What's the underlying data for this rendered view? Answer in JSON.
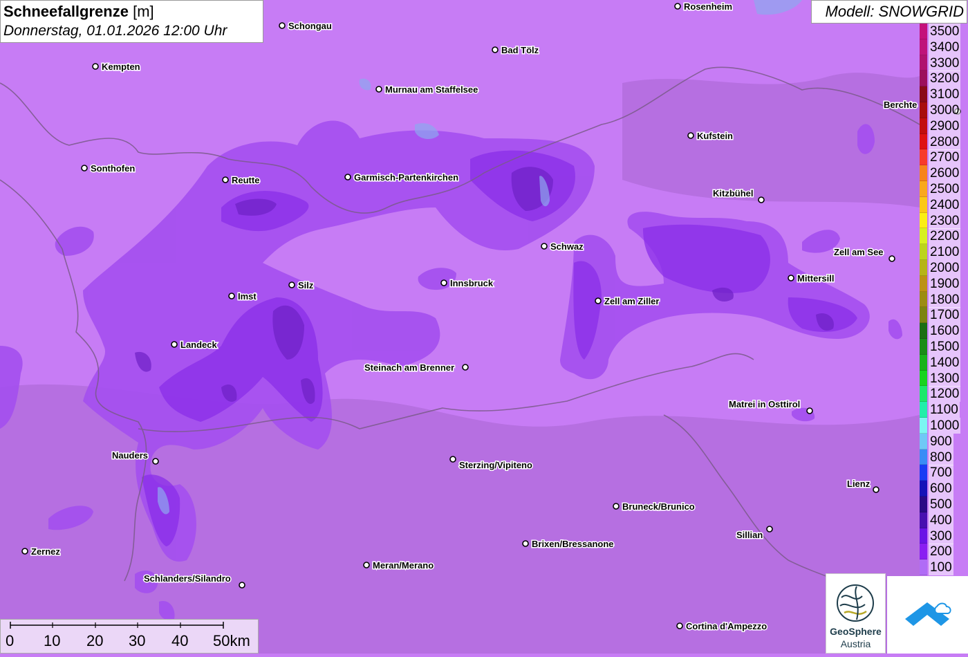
{
  "header": {
    "title": "Schneefallgrenze",
    "unit": "[m]",
    "datetime": "Donnerstag, 01.01.2026 12:00 Uhr",
    "model": "Modell: SNOWGRID"
  },
  "legend": {
    "items": [
      {
        "label": "3500",
        "color": "#c4127a"
      },
      {
        "label": "3400",
        "color": "#bf137a"
      },
      {
        "label": "3300",
        "color": "#b0126f"
      },
      {
        "label": "3200",
        "color": "#9c0f5c"
      },
      {
        "label": "3100",
        "color": "#8a0a18"
      },
      {
        "label": "3000",
        "color": "#a80d0d"
      },
      {
        "label": "2900",
        "color": "#c20e0e"
      },
      {
        "label": "2800",
        "color": "#de1212"
      },
      {
        "label": "2700",
        "color": "#f73b2b"
      },
      {
        "label": "2600",
        "color": "#f7841c"
      },
      {
        "label": "2500",
        "color": "#f9a81e"
      },
      {
        "label": "2400",
        "color": "#fbc817"
      },
      {
        "label": "2300",
        "color": "#fbee16"
      },
      {
        "label": "2200",
        "color": "#d7f020"
      },
      {
        "label": "2100",
        "color": "#bcd41c"
      },
      {
        "label": "2000",
        "color": "#b6b418"
      },
      {
        "label": "1900",
        "color": "#bc9214"
      },
      {
        "label": "1800",
        "color": "#9c8c12"
      },
      {
        "label": "1700",
        "color": "#7c8410"
      },
      {
        "label": "1600",
        "color": "#1c6e12"
      },
      {
        "label": "1500",
        "color": "#1a8c18"
      },
      {
        "label": "1400",
        "color": "#19b21c"
      },
      {
        "label": "1300",
        "color": "#1ad321"
      },
      {
        "label": "1200",
        "color": "#1ee86c"
      },
      {
        "label": "1100",
        "color": "#22eeaa"
      },
      {
        "label": "1000",
        "color": "#7cf6f2"
      },
      {
        "label": "900",
        "color": "#70c8f6"
      },
      {
        "label": "800",
        "color": "#3a8cf6"
      },
      {
        "label": "700",
        "color": "#1a3cf4"
      },
      {
        "label": "600",
        "color": "#1612b8"
      },
      {
        "label": "500",
        "color": "#2a0a86"
      },
      {
        "label": "400",
        "color": "#4810b0"
      },
      {
        "label": "300",
        "color": "#6a14e6"
      },
      {
        "label": "200",
        "color": "#8a1ef2"
      },
      {
        "label": "100",
        "color": "#b06cf6"
      }
    ]
  },
  "scale": {
    "labels": [
      "0",
      "10",
      "20",
      "30",
      "40",
      "50km"
    ]
  },
  "logos": {
    "geosphere_name": "GeoSphere",
    "geosphere_sub": "Austria"
  },
  "colors": {
    "base": "#c77cf5",
    "band_200": "#a44fef",
    "band_300": "#8a2ee8",
    "band_400": "#6e21c4",
    "border": "#7a5a8a"
  },
  "cities": [
    {
      "name": "Schongau"
    },
    {
      "name": "Rosenheim"
    },
    {
      "name": "Bad Tölz"
    },
    {
      "name": "Kempten"
    },
    {
      "name": "Murnau am Staffelsee"
    },
    {
      "name": "Berchte"
    },
    {
      "name": "Kufstein"
    },
    {
      "name": "Sonthofen"
    },
    {
      "name": "Reutte"
    },
    {
      "name": "Garmisch-Partenkirchen"
    },
    {
      "name": "Kitzbühel"
    },
    {
      "name": "Schwaz"
    },
    {
      "name": "Zell am See"
    },
    {
      "name": "Mittersill"
    },
    {
      "name": "Innsbruck"
    },
    {
      "name": "Silz"
    },
    {
      "name": "Imst"
    },
    {
      "name": "Zell am Ziller"
    },
    {
      "name": "Landeck"
    },
    {
      "name": "Steinach am Brenner"
    },
    {
      "name": "Matrei in Osttirol"
    },
    {
      "name": "Nauders"
    },
    {
      "name": "Sterzing/Vipiteno"
    },
    {
      "name": "Lienz"
    },
    {
      "name": "Bruneck/Brunico"
    },
    {
      "name": "Sillian"
    },
    {
      "name": "Brixen/Bressanone"
    },
    {
      "name": "Zernez"
    },
    {
      "name": "Meran/Merano"
    },
    {
      "name": "Schlanders/Silandro"
    },
    {
      "name": "Cortina d'Ampezzo"
    }
  ]
}
